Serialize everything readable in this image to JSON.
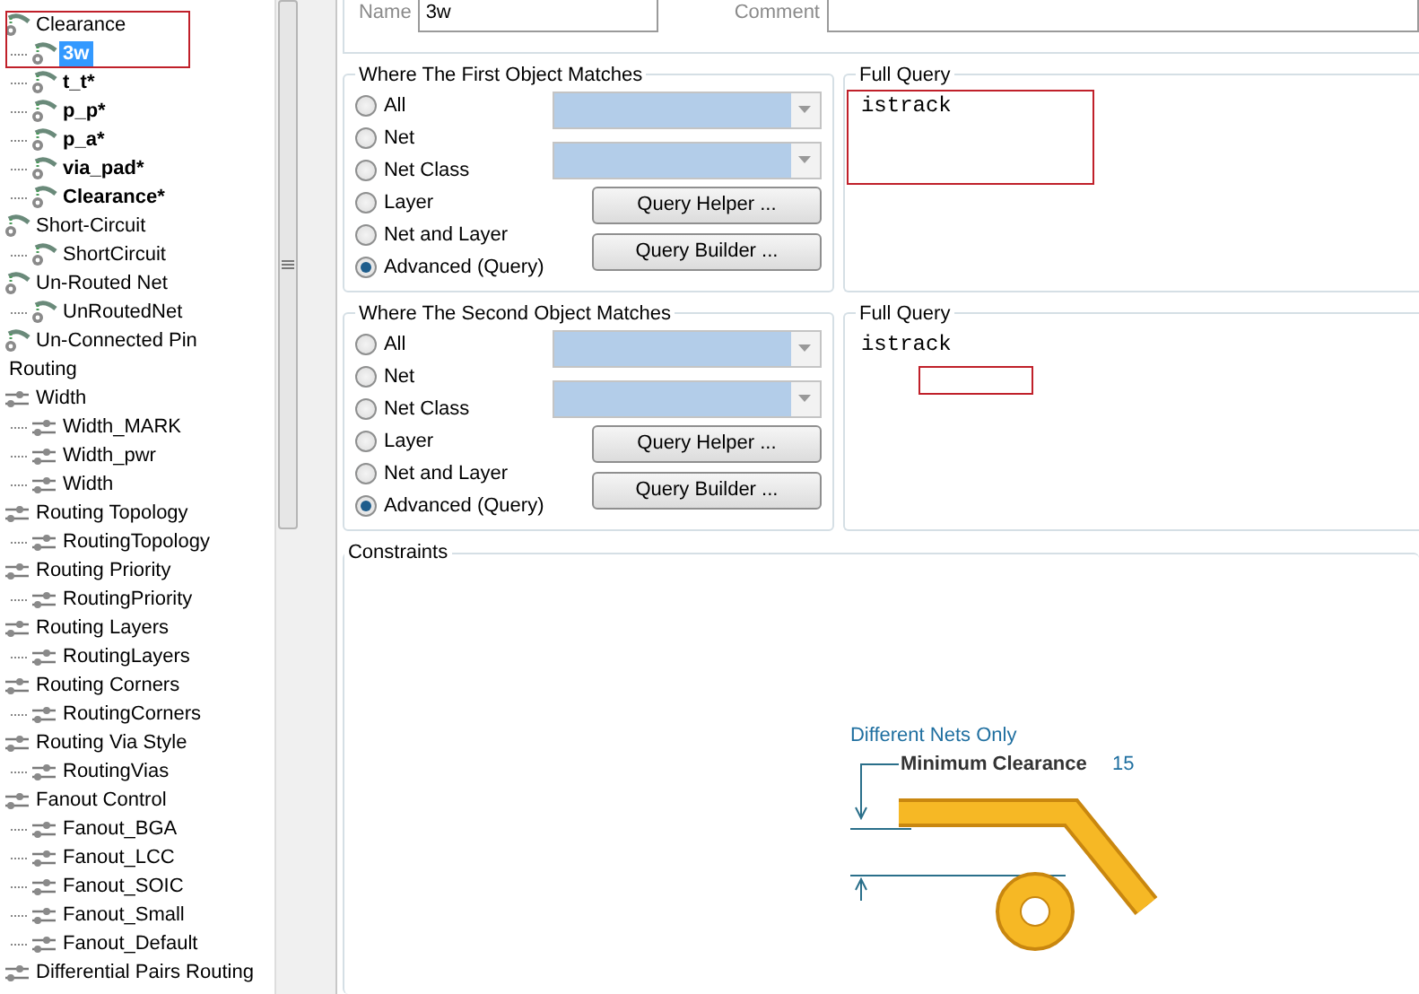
{
  "tree": [
    {
      "kind": "clearance",
      "label": "Clearance",
      "selected": false,
      "bold": false,
      "children": [
        {
          "kind": "clearance",
          "label": "3w",
          "selected": true,
          "bold": true
        },
        {
          "kind": "clearance",
          "label": "t_t*",
          "selected": false,
          "bold": true
        },
        {
          "kind": "clearance",
          "label": "p_p*",
          "selected": false,
          "bold": true
        },
        {
          "kind": "clearance",
          "label": "p_a*",
          "selected": false,
          "bold": true
        },
        {
          "kind": "clearance",
          "label": "via_pad*",
          "selected": false,
          "bold": true
        },
        {
          "kind": "clearance",
          "label": "Clearance*",
          "selected": false,
          "bold": true
        }
      ]
    },
    {
      "kind": "clearance",
      "label": "Short-Circuit",
      "selected": false,
      "bold": false,
      "children": [
        {
          "kind": "clearance",
          "label": "ShortCircuit",
          "selected": false,
          "bold": false
        }
      ]
    },
    {
      "kind": "clearance",
      "label": "Un-Routed Net",
      "selected": false,
      "bold": false,
      "children": [
        {
          "kind": "clearance",
          "label": "UnRoutedNet",
          "selected": false,
          "bold": false
        }
      ]
    },
    {
      "kind": "clearance",
      "label": "Un-Connected Pin",
      "selected": false,
      "bold": false
    },
    {
      "kind": "category",
      "label": "Routing",
      "selected": false,
      "bold": false
    },
    {
      "kind": "routing",
      "label": "Width",
      "selected": false,
      "bold": false,
      "children": [
        {
          "kind": "routing",
          "label": "Width_MARK",
          "selected": false,
          "bold": false
        },
        {
          "kind": "routing",
          "label": "Width_pwr",
          "selected": false,
          "bold": false
        },
        {
          "kind": "routing",
          "label": "Width",
          "selected": false,
          "bold": false
        }
      ]
    },
    {
      "kind": "routing",
      "label": "Routing Topology",
      "selected": false,
      "bold": false,
      "children": [
        {
          "kind": "routing",
          "label": "RoutingTopology",
          "selected": false,
          "bold": false
        }
      ]
    },
    {
      "kind": "routing",
      "label": "Routing Priority",
      "selected": false,
      "bold": false,
      "children": [
        {
          "kind": "routing",
          "label": "RoutingPriority",
          "selected": false,
          "bold": false
        }
      ]
    },
    {
      "kind": "routing",
      "label": "Routing Layers",
      "selected": false,
      "bold": false,
      "children": [
        {
          "kind": "routing",
          "label": "RoutingLayers",
          "selected": false,
          "bold": false
        }
      ]
    },
    {
      "kind": "routing",
      "label": "Routing Corners",
      "selected": false,
      "bold": false,
      "children": [
        {
          "kind": "routing",
          "label": "RoutingCorners",
          "selected": false,
          "bold": false
        }
      ]
    },
    {
      "kind": "routing",
      "label": "Routing Via Style",
      "selected": false,
      "bold": false,
      "children": [
        {
          "kind": "routing",
          "label": "RoutingVias",
          "selected": false,
          "bold": false
        }
      ]
    },
    {
      "kind": "routing",
      "label": "Fanout Control",
      "selected": false,
      "bold": false,
      "children": [
        {
          "kind": "routing",
          "label": "Fanout_BGA",
          "selected": false,
          "bold": false
        },
        {
          "kind": "routing",
          "label": "Fanout_LCC",
          "selected": false,
          "bold": false
        },
        {
          "kind": "routing",
          "label": "Fanout_SOIC",
          "selected": false,
          "bold": false
        },
        {
          "kind": "routing",
          "label": "Fanout_Small",
          "selected": false,
          "bold": false
        },
        {
          "kind": "routing",
          "label": "Fanout_Default",
          "selected": false,
          "bold": false
        }
      ]
    },
    {
      "kind": "routing",
      "label": "Differential Pairs Routing",
      "selected": false,
      "bold": false
    }
  ],
  "name_field": {
    "label": "Name",
    "value": "3w"
  },
  "comment_field": {
    "label": "Comment"
  },
  "matches": [
    {
      "title": "Where The First Object Matches",
      "options": [
        {
          "label": "All",
          "selected": false
        },
        {
          "label": "Net",
          "selected": false
        },
        {
          "label": "Net Class",
          "selected": false
        },
        {
          "label": "Layer",
          "selected": false
        },
        {
          "label": "Net and Layer",
          "selected": false
        },
        {
          "label": "Advanced (Query)",
          "selected": true
        }
      ],
      "buttons": [
        "Query Helper ...",
        "Query Builder ..."
      ],
      "query": {
        "label": "Full Query",
        "text": "istrack"
      }
    },
    {
      "title": "Where The Second Object Matches",
      "options": [
        {
          "label": "All",
          "selected": false
        },
        {
          "label": "Net",
          "selected": false
        },
        {
          "label": "Net Class",
          "selected": false
        },
        {
          "label": "Layer",
          "selected": false
        },
        {
          "label": "Net and Layer",
          "selected": false
        },
        {
          "label": "Advanced (Query)",
          "selected": true
        }
      ],
      "buttons": [
        "Query Helper ...",
        "Query Builder ..."
      ],
      "query": {
        "label": "Full Query",
        "text": "istrack"
      }
    }
  ],
  "constraints": {
    "title": "Constraints",
    "scope": "Different Nets Only",
    "rule_label": "Minimum Clearance",
    "rule_value": "15"
  }
}
